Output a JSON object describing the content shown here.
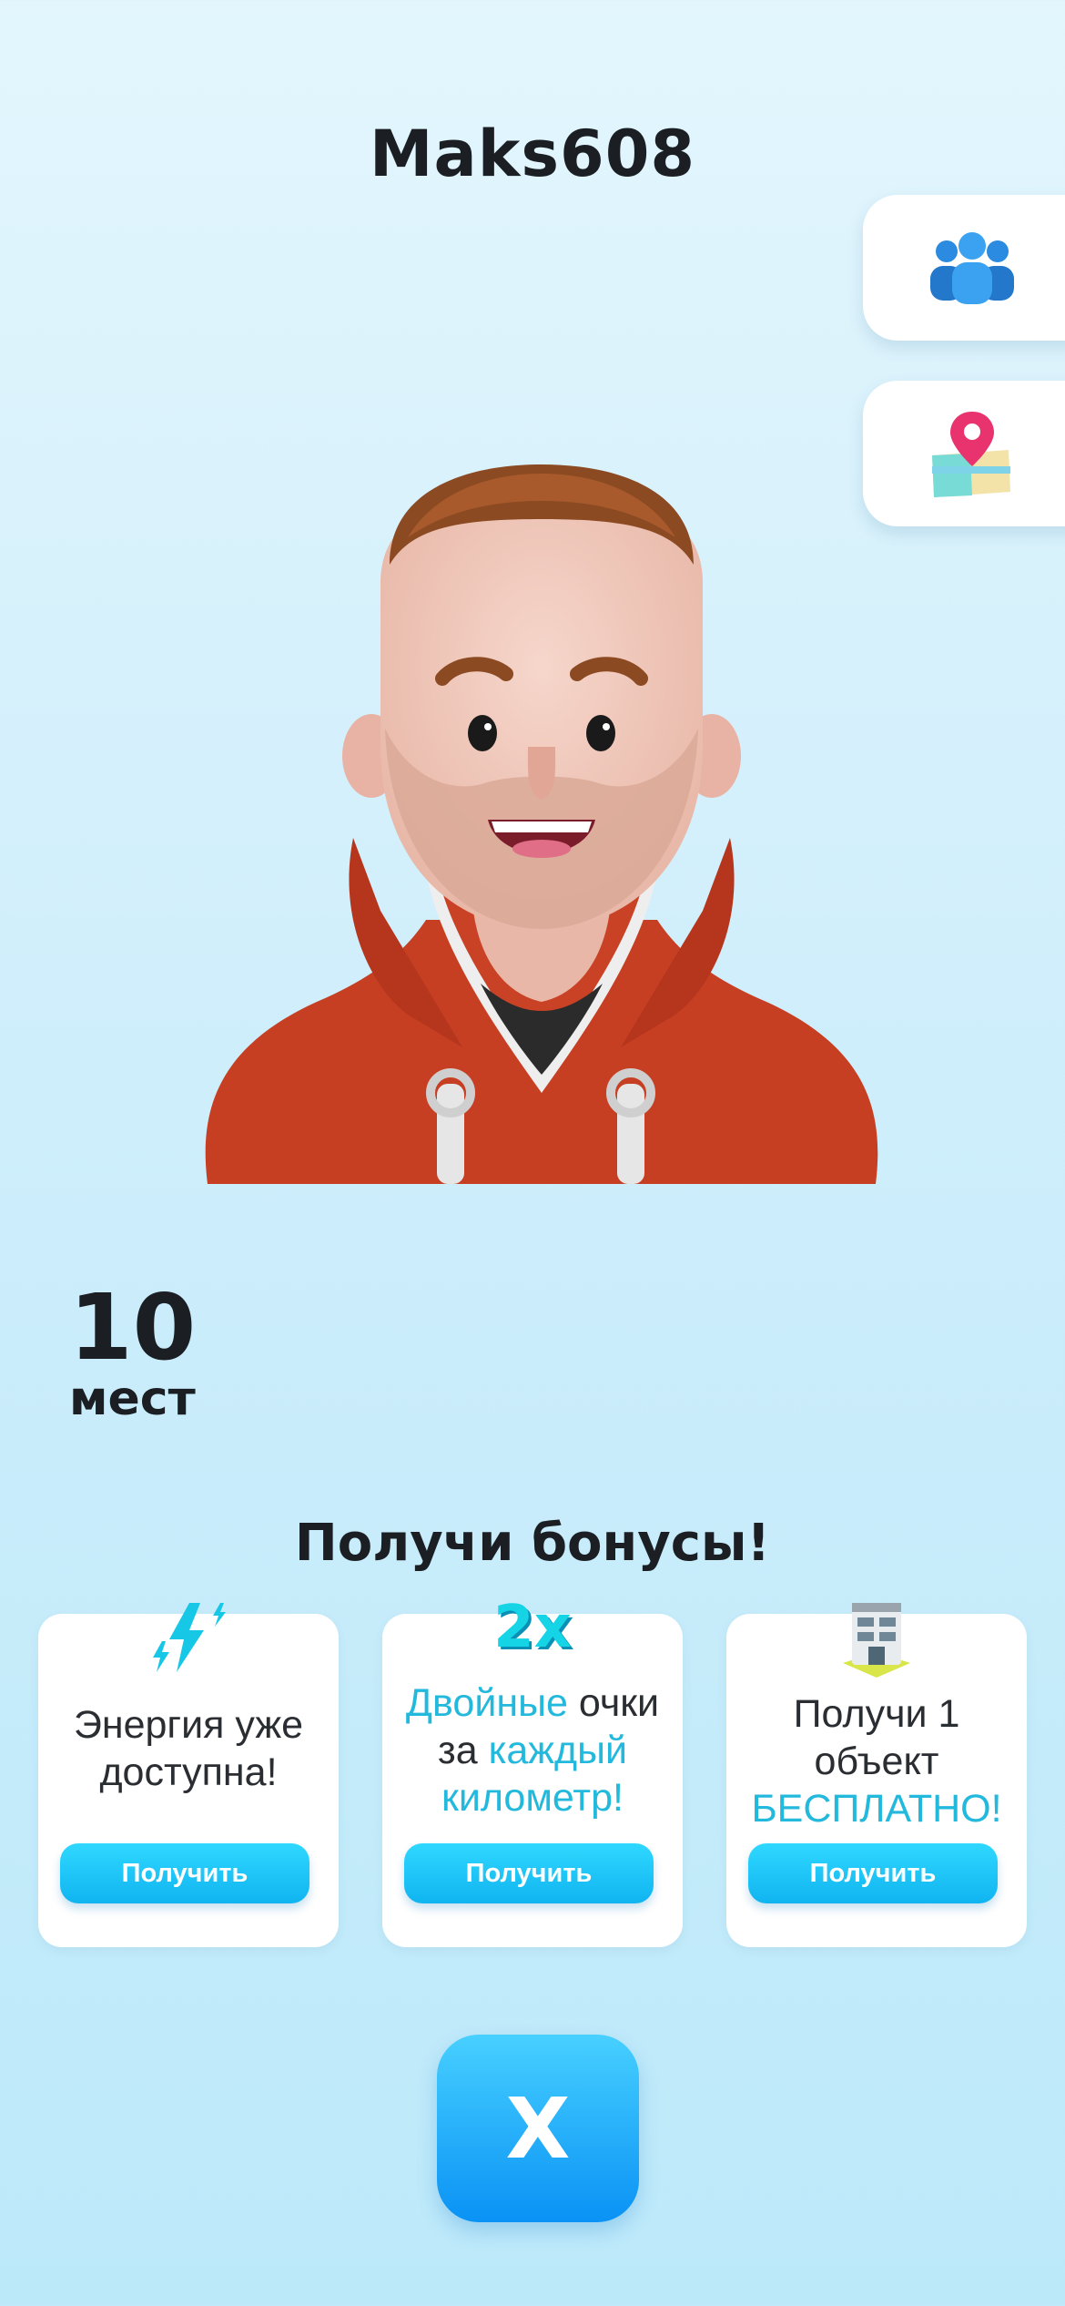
{
  "header": {
    "username": "Maks608"
  },
  "side_buttons": [
    {
      "icon": "friends-icon"
    },
    {
      "icon": "map-pin-icon"
    }
  ],
  "avatar": {
    "icon": "user-avatar"
  },
  "rank": {
    "value": "10",
    "label": "мест"
  },
  "bonuses": {
    "title": "Получи бонусы!",
    "cards": [
      {
        "icon": "energy-bolt-icon",
        "line1": "Энергия уже",
        "line2": "доступна!",
        "button": "Получить"
      },
      {
        "badge": "2x",
        "w1": "Двойные",
        "w2": " очки",
        "w3": "за ",
        "w4": "каждый",
        "w5": "километр!",
        "button": "Получить"
      },
      {
        "icon": "building-icon",
        "line1": "Получи 1",
        "line2": "объект",
        "line3": "БЕСПЛАТНО!",
        "button": "Получить"
      }
    ]
  },
  "close_button": {
    "label": "X"
  },
  "colors": {
    "accent": "#22b9dd",
    "button": "#10b4f0",
    "hoodie": "#c93f24"
  }
}
